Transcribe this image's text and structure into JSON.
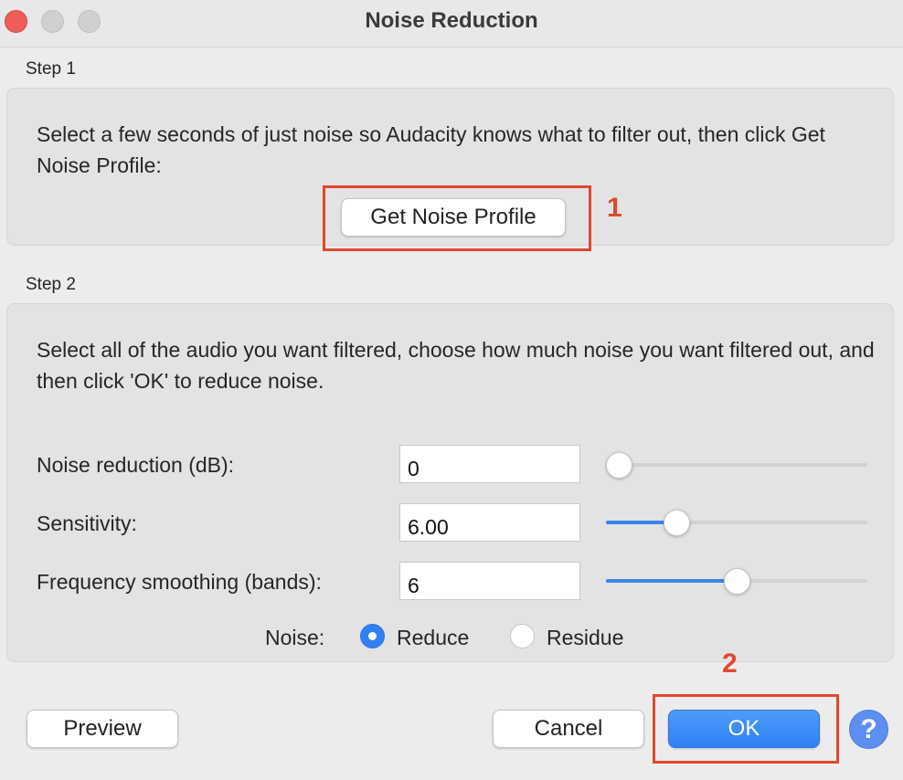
{
  "window": {
    "title": "Noise Reduction"
  },
  "step1": {
    "label": "Step 1",
    "instructions": "Select a few seconds of just noise so Audacity knows what to filter out, then click Get Noise Profile:",
    "get_profile_button": "Get Noise Profile",
    "annotation": "1"
  },
  "step2": {
    "label": "Step 2",
    "instructions": "Select all of the audio you want filtered, choose how much noise you want filtered out, and then click 'OK' to reduce noise.",
    "rows": [
      {
        "label": "Noise reduction (dB):",
        "value": "0",
        "slider_fraction": 0.05
      },
      {
        "label": "Sensitivity:",
        "value": "6.00",
        "slider_fraction": 0.27
      },
      {
        "label": "Frequency smoothing (bands):",
        "value": "6",
        "slider_fraction": 0.5
      }
    ],
    "noise_label": "Noise:",
    "noise_options": [
      {
        "label": "Reduce",
        "checked": true
      },
      {
        "label": "Residue",
        "checked": false
      }
    ]
  },
  "footer": {
    "preview_button": "Preview",
    "cancel_button": "Cancel",
    "ok_button": "OK",
    "ok_annotation": "2",
    "help_icon": "?"
  },
  "colors": {
    "accent": "#2f80f4",
    "annotation": "#e0482f"
  }
}
